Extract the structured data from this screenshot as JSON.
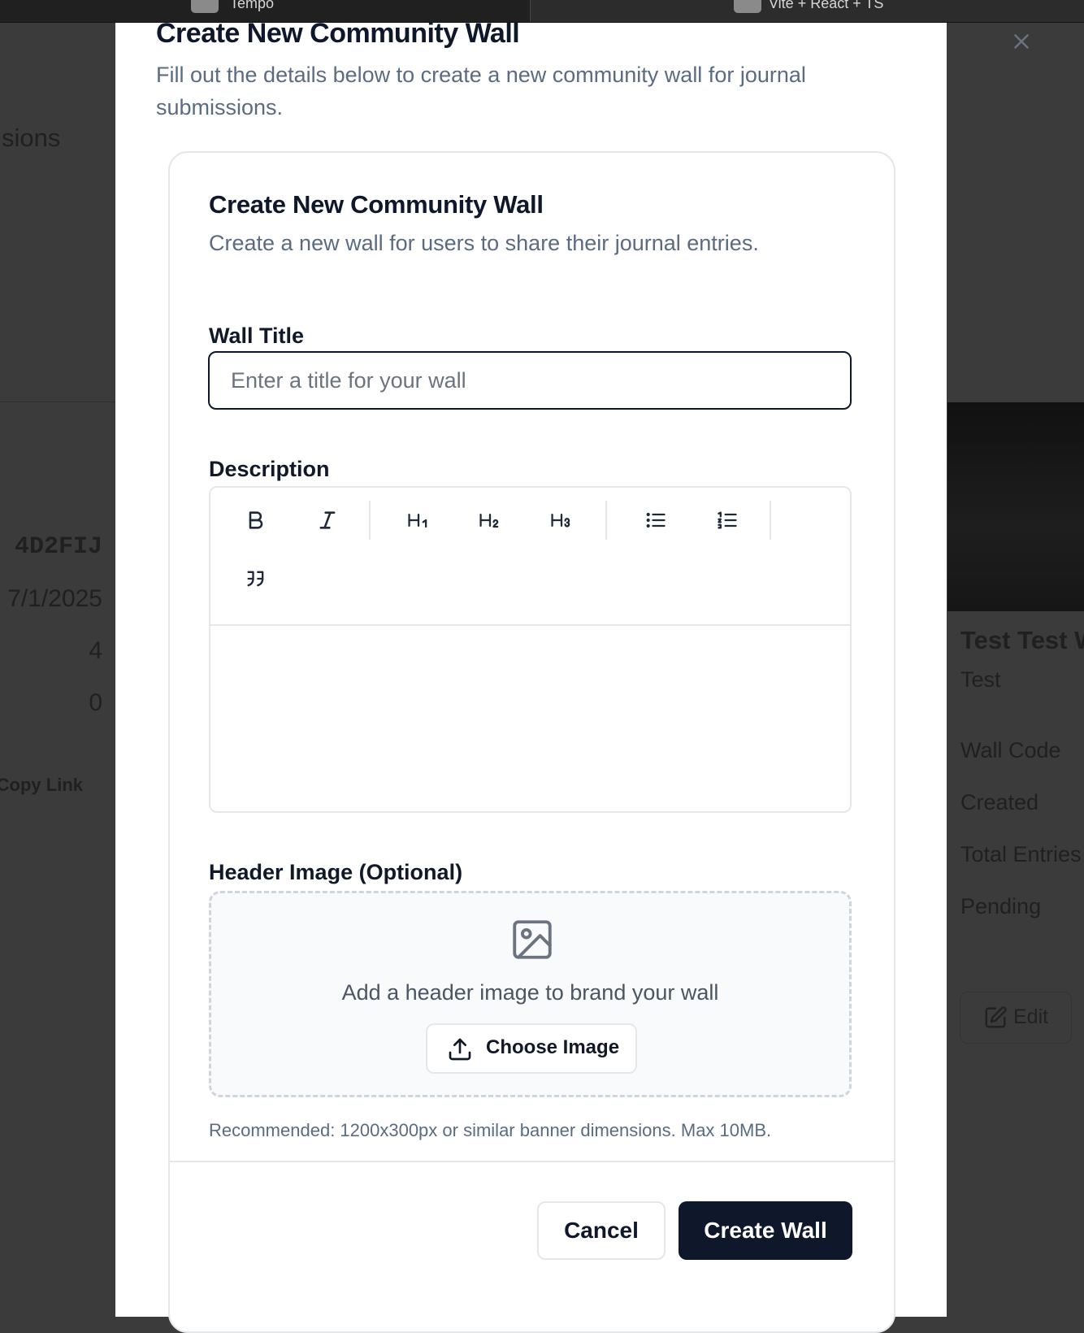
{
  "browser": {
    "tabs": [
      {
        "label": "Tempo"
      },
      {
        "label": "Vite + React + TS"
      }
    ]
  },
  "background": {
    "left": {
      "heading_fragment": "sions",
      "wall_code": "4D2FIJ",
      "created": "7/1/2025",
      "total_entries": "4",
      "pending": "0",
      "copy_link": "Copy Link"
    },
    "right": {
      "title_fragment": "Test Test W",
      "description": "Test",
      "wall_code_label": "Wall Code",
      "created_label": "Created",
      "total_entries_label": "Total Entries",
      "pending_label": "Pending",
      "edit_label": "Edit"
    }
  },
  "dialog": {
    "title": "Create New Community Wall",
    "description": "Fill out the details below to create a new community wall for journal submissions.",
    "close_icon": "close-icon",
    "form": {
      "title": "Create New Community Wall",
      "subtitle": "Create a new wall for users to share their journal entries.",
      "wall_title": {
        "label": "Wall Title",
        "value": "",
        "placeholder": "Enter a title for your wall"
      },
      "description": {
        "label": "Description",
        "toolbar": [
          "bold-icon",
          "italic-icon",
          "heading-1-icon",
          "heading-2-icon",
          "heading-3-icon",
          "bullet-list-icon",
          "numbered-list-icon",
          "blockquote-icon"
        ],
        "value": ""
      },
      "header_image": {
        "label": "Header Image (Optional)",
        "icon": "image-icon",
        "prompt": "Add a header image to brand your wall",
        "button_label": "Choose Image",
        "button_icon": "upload-icon",
        "hint": "Recommended: 1200x300px or similar banner dimensions. Max 10MB."
      },
      "cancel_label": "Cancel",
      "submit_label": "Create Wall"
    }
  }
}
